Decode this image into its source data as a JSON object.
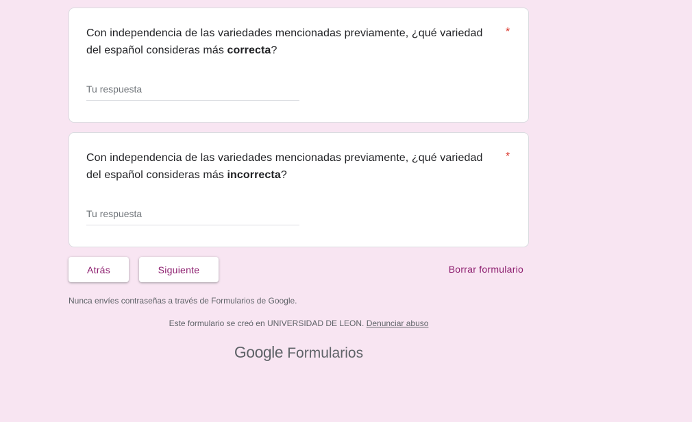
{
  "questions": [
    {
      "text_before": "Con independencia de las variedades mencionadas previamente, ¿qué variedad del español consideras más ",
      "text_emphasis": "correcta",
      "text_after": "?",
      "required_mark": "*",
      "answer_placeholder": "Tu respuesta",
      "answer_value": ""
    },
    {
      "text_before": "Con independencia de las variedades mencionadas previamente, ¿qué variedad del español consideras más ",
      "text_emphasis": "incorrecta",
      "text_after": "?",
      "required_mark": "*",
      "answer_placeholder": "Tu respuesta",
      "answer_value": ""
    }
  ],
  "navigation": {
    "back_label": "Atrás",
    "next_label": "Siguiente",
    "clear_label": "Borrar formulario"
  },
  "footer": {
    "password_warning": "Nunca envíes contraseñas a través de Formularios de Google.",
    "creator_text": "Este formulario se creó en UNIVERSIDAD DE LEON.",
    "abuse_link": "Denunciar abuso",
    "brand_google": "Google",
    "brand_product": "Formularios"
  },
  "colors": {
    "background": "#f8e5f2",
    "accent": "#8c1d6e",
    "required": "#d93025"
  }
}
